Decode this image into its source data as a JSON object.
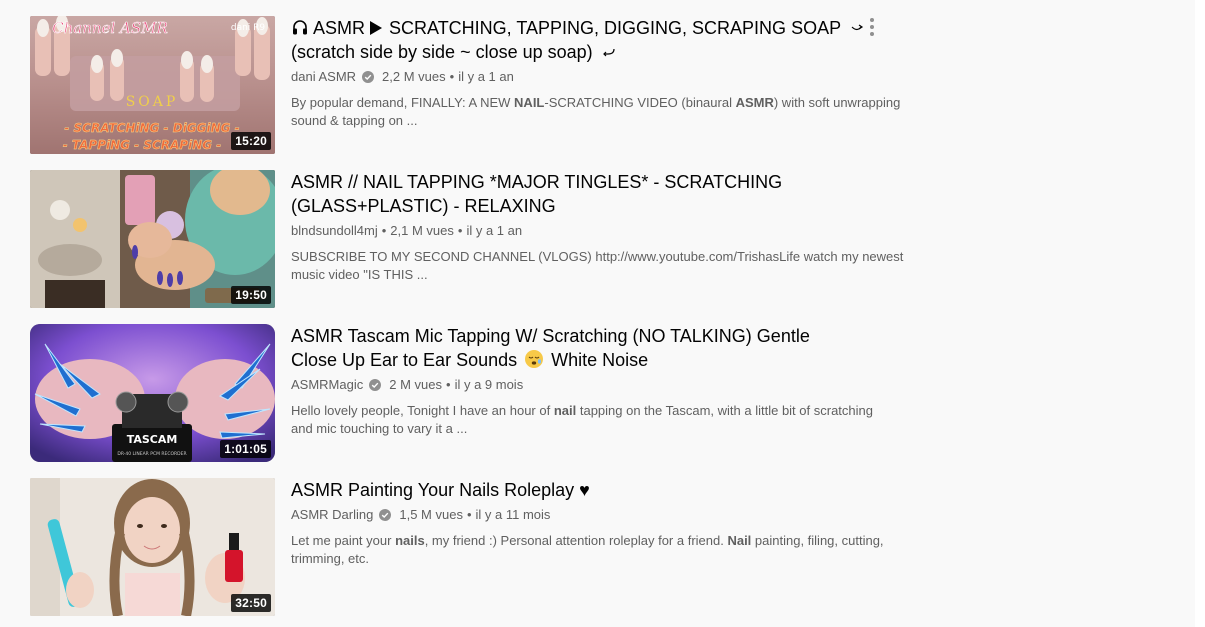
{
  "results": [
    {
      "title_line1": "ASMR",
      "title_line1b": "SCRATCHING, TAPPING, DIGGING, SCRAPING SOAP",
      "title_line2": "(scratch side by side ~ close up soap)",
      "channel": "dani ASMR",
      "verified": true,
      "views": "2,2 M vues",
      "age": "il y a 1 an",
      "desc_line1_pre": "By popular demand, FINALLY: A NEW ",
      "desc_line1_bold1": "NAIL",
      "desc_line1_mid": "-SCRATCHING VIDEO (binaural ",
      "desc_line1_bold2": "ASMR",
      "desc_line1_post": ") with soft unwrapping",
      "desc_line2": "sound & tapping on ...",
      "duration": "15:20",
      "thumb_text_top": "Channel ASMR",
      "thumb_text_corner": "dani R9",
      "thumb_text_mid": "SOAP",
      "thumb_text_b1": "- SCRATCHiNG - DiGGiNG -",
      "thumb_text_b2": "- TAPPiNG - SCRAPiNG -"
    },
    {
      "title_line1": "ASMR // NAIL TAPPING *MAJOR TINGLES* - SCRATCHING",
      "title_line2": "(GLASS+PLASTIC) - RELAXING",
      "channel": "blndsundoll4mj",
      "verified": false,
      "views": "2,1 M vues",
      "age": "il y a 1 an",
      "desc_line1": "SUBSCRIBE TO MY SECOND CHANNEL (VLOGS) http://www.youtube.com/TrishasLife watch my newest",
      "desc_line2": "music video \"IS THIS ...",
      "duration": "19:50"
    },
    {
      "title_line1": "ASMR Tascam Mic Tapping W/ Scratching (NO TALKING) Gentle",
      "title_line2_pre": "Close Up Ear to Ear Sounds",
      "title_line2_post": "White Noise",
      "channel": "ASMRMagic",
      "verified": true,
      "views": "2 M vues",
      "age": "il y a 9 mois",
      "desc_line1_pre": "Hello lovely people, Tonight I have an hour of ",
      "desc_line1_bold": "nail",
      "desc_line1_post": " tapping on the Tascam, with a little bit of scratching",
      "desc_line2": "and mic touching to vary it a ...",
      "duration": "1:01:05",
      "thumb_text_brand": "TASCAM",
      "thumb_text_model": "DR-40 LINEAR PCM RECORDER"
    },
    {
      "title_line1": "ASMR Painting Your Nails Roleplay ♥",
      "channel": "ASMR Darling",
      "verified": true,
      "views": "1,5 M vues",
      "age": "il y a 11 mois",
      "desc_line1_pre": "Let me paint your ",
      "desc_line1_bold1": "nails",
      "desc_line1_mid": ", my friend :) Personal attention roleplay for a friend. ",
      "desc_line1_bold2": "Nail",
      "desc_line1_post": " painting, filing, cutting,",
      "desc_line2": "trimming, etc.",
      "duration": "32:50"
    }
  ],
  "meta_separator": "•",
  "colors": {
    "background": "#f9f9f9",
    "title": "#030303",
    "meta": "#606060",
    "duration_bg": "#000000"
  },
  "icons": {
    "headphones": "headphones-icon",
    "play": "play-triangle-icon",
    "verified": "verified-check-icon",
    "menu": "more-vert-icon",
    "sleepy_emoji": "sleepy-face-icon"
  }
}
